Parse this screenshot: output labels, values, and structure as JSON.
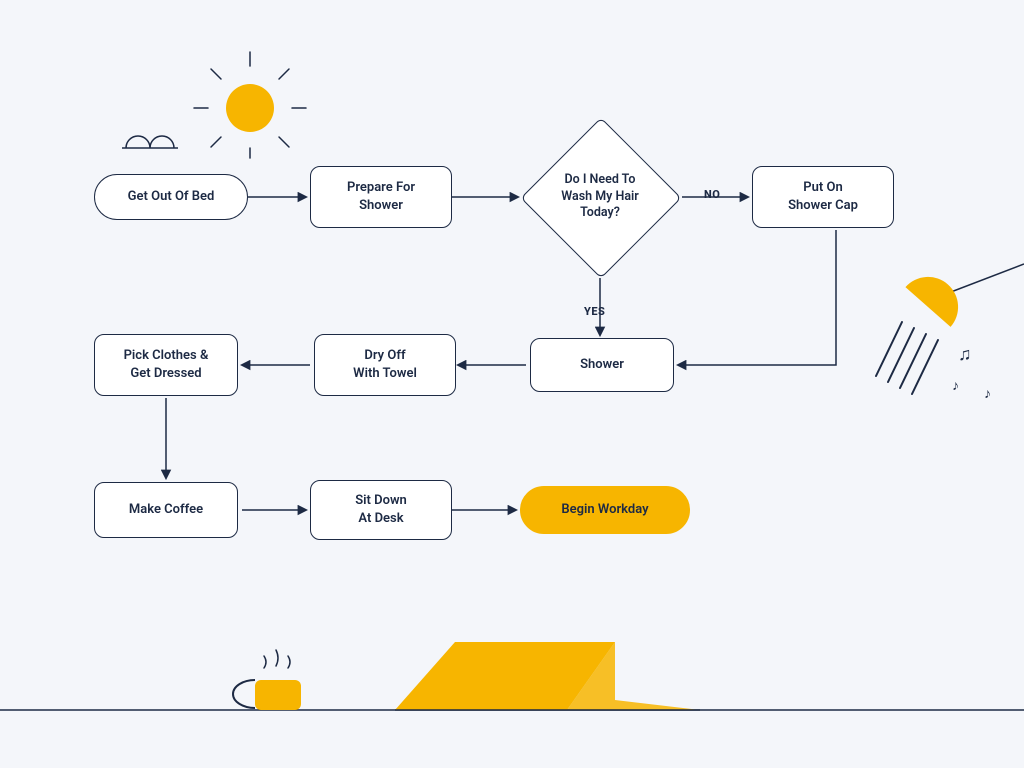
{
  "flow": {
    "nodes": {
      "start": {
        "label": "Get Out Of Bed",
        "type": "terminator"
      },
      "prepare": {
        "label": "Prepare For\nShower",
        "type": "process"
      },
      "decide": {
        "label": "Do I Need To\nWash My Hair\nToday?",
        "type": "decision"
      },
      "cap": {
        "label": "Put On\nShower Cap",
        "type": "process"
      },
      "shower": {
        "label": "Shower",
        "type": "process"
      },
      "dry": {
        "label": "Dry Off\nWith Towel",
        "type": "process"
      },
      "dress": {
        "label": "Pick Clothes &\nGet Dressed",
        "type": "process"
      },
      "coffee": {
        "label": "Make Coffee",
        "type": "process"
      },
      "desk": {
        "label": "Sit Down\nAt Desk",
        "type": "process"
      },
      "end": {
        "label": "Begin Workday",
        "type": "terminator-end"
      }
    },
    "edges": [
      {
        "from": "start",
        "to": "prepare"
      },
      {
        "from": "prepare",
        "to": "decide"
      },
      {
        "from": "decide",
        "to": "cap",
        "label": "NO"
      },
      {
        "from": "decide",
        "to": "shower",
        "label": "YES"
      },
      {
        "from": "cap",
        "to": "shower"
      },
      {
        "from": "shower",
        "to": "dry"
      },
      {
        "from": "dry",
        "to": "dress"
      },
      {
        "from": "dress",
        "to": "coffee"
      },
      {
        "from": "coffee",
        "to": "desk"
      },
      {
        "from": "desk",
        "to": "end"
      }
    ],
    "edge_labels": {
      "no": "NO",
      "yes": "YES"
    }
  },
  "decorations": {
    "sun": "sun-icon",
    "cloud": "cloud-icon",
    "showerhead": "showerhead-icon",
    "music": "music-notes-icon",
    "mug": "coffee-mug-icon",
    "laptop": "laptop-icon"
  },
  "colors": {
    "bg": "#f4f6fa",
    "ink": "#1d2a44",
    "accent": "#f7b500",
    "node": "#ffffff"
  }
}
